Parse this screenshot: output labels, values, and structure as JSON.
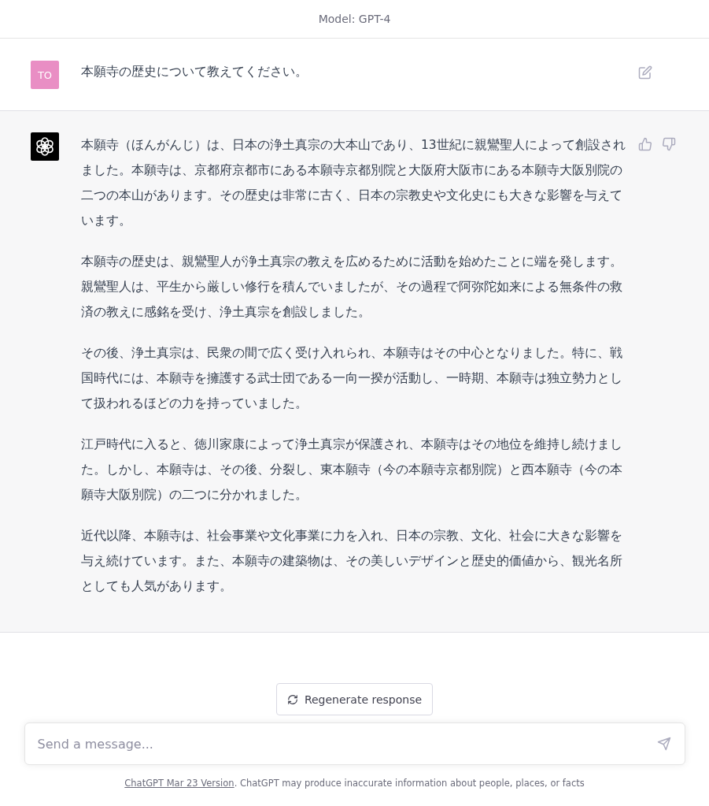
{
  "header": {
    "title": "Model: GPT-4"
  },
  "messages": [
    {
      "kind": "user",
      "avatar": "TO",
      "paragraphs": [
        "本願寺の歴史について教えてください。"
      ]
    },
    {
      "kind": "assistant",
      "paragraphs": [
        "本願寺（ほんがんじ）は、日本の浄土真宗の大本山であり、13世紀に親鸞聖人によって創設されました。本願寺は、京都府京都市にある本願寺京都別院と大阪府大阪市にある本願寺大阪別院の二つの本山があります。その歴史は非常に古く、日本の宗教史や文化史にも大きな影響を与えています。",
        "本願寺の歴史は、親鸞聖人が浄土真宗の教えを広めるために活動を始めたことに端を発します。親鸞聖人は、平生から厳しい修行を積んでいましたが、その過程で阿弥陀如来による無条件の救済の教えに感銘を受け、浄土真宗を創設しました。",
        "その後、浄土真宗は、民衆の間で広く受け入れられ、本願寺はその中心となりました。特に、戦国時代には、本願寺を擁護する武士団である一向一揆が活動し、一時期、本願寺は独立勢力として扱われるほどの力を持っていました。",
        "江戸時代に入ると、徳川家康によって浄土真宗が保護され、本願寺はその地位を維持し続けました。しかし、本願寺は、その後、分裂し、東本願寺（今の本願寺京都別院）と西本願寺（今の本願寺大阪別院）の二つに分かれました。",
        "近代以降、本願寺は、社会事業や文化事業に力を入れ、日本の宗教、文化、社会に大きな影響を与え続けています。また、本願寺の建築物は、その美しいデザインと歴史的価値から、観光名所としても人気があります。"
      ]
    }
  ],
  "regenerate_button": {
    "label": "Regenerate response"
  },
  "composer": {
    "placeholder": "Send a message..."
  },
  "footer": {
    "link": "ChatGPT Mar 23 Version",
    "text": ". ChatGPT may produce inaccurate information about people, places, or facts"
  }
}
